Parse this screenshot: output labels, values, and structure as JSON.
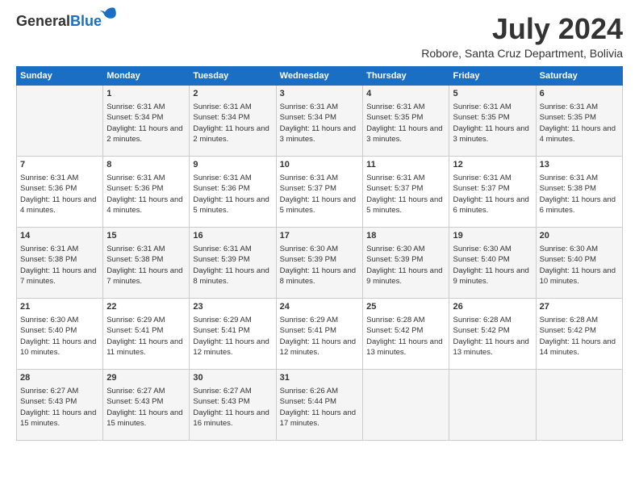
{
  "logo": {
    "general": "General",
    "blue": "Blue"
  },
  "header": {
    "month": "July 2024",
    "location": "Robore, Santa Cruz Department, Bolivia"
  },
  "weekdays": [
    "Sunday",
    "Monday",
    "Tuesday",
    "Wednesday",
    "Thursday",
    "Friday",
    "Saturday"
  ],
  "weeks": [
    [
      {
        "day": "",
        "sunrise": "",
        "sunset": "",
        "daylight": ""
      },
      {
        "day": "1",
        "sunrise": "Sunrise: 6:31 AM",
        "sunset": "Sunset: 5:34 PM",
        "daylight": "Daylight: 11 hours and 2 minutes."
      },
      {
        "day": "2",
        "sunrise": "Sunrise: 6:31 AM",
        "sunset": "Sunset: 5:34 PM",
        "daylight": "Daylight: 11 hours and 2 minutes."
      },
      {
        "day": "3",
        "sunrise": "Sunrise: 6:31 AM",
        "sunset": "Sunset: 5:34 PM",
        "daylight": "Daylight: 11 hours and 3 minutes."
      },
      {
        "day": "4",
        "sunrise": "Sunrise: 6:31 AM",
        "sunset": "Sunset: 5:35 PM",
        "daylight": "Daylight: 11 hours and 3 minutes."
      },
      {
        "day": "5",
        "sunrise": "Sunrise: 6:31 AM",
        "sunset": "Sunset: 5:35 PM",
        "daylight": "Daylight: 11 hours and 3 minutes."
      },
      {
        "day": "6",
        "sunrise": "Sunrise: 6:31 AM",
        "sunset": "Sunset: 5:35 PM",
        "daylight": "Daylight: 11 hours and 4 minutes."
      }
    ],
    [
      {
        "day": "7",
        "sunrise": "Sunrise: 6:31 AM",
        "sunset": "Sunset: 5:36 PM",
        "daylight": "Daylight: 11 hours and 4 minutes."
      },
      {
        "day": "8",
        "sunrise": "Sunrise: 6:31 AM",
        "sunset": "Sunset: 5:36 PM",
        "daylight": "Daylight: 11 hours and 4 minutes."
      },
      {
        "day": "9",
        "sunrise": "Sunrise: 6:31 AM",
        "sunset": "Sunset: 5:36 PM",
        "daylight": "Daylight: 11 hours and 5 minutes."
      },
      {
        "day": "10",
        "sunrise": "Sunrise: 6:31 AM",
        "sunset": "Sunset: 5:37 PM",
        "daylight": "Daylight: 11 hours and 5 minutes."
      },
      {
        "day": "11",
        "sunrise": "Sunrise: 6:31 AM",
        "sunset": "Sunset: 5:37 PM",
        "daylight": "Daylight: 11 hours and 5 minutes."
      },
      {
        "day": "12",
        "sunrise": "Sunrise: 6:31 AM",
        "sunset": "Sunset: 5:37 PM",
        "daylight": "Daylight: 11 hours and 6 minutes."
      },
      {
        "day": "13",
        "sunrise": "Sunrise: 6:31 AM",
        "sunset": "Sunset: 5:38 PM",
        "daylight": "Daylight: 11 hours and 6 minutes."
      }
    ],
    [
      {
        "day": "14",
        "sunrise": "Sunrise: 6:31 AM",
        "sunset": "Sunset: 5:38 PM",
        "daylight": "Daylight: 11 hours and 7 minutes."
      },
      {
        "day": "15",
        "sunrise": "Sunrise: 6:31 AM",
        "sunset": "Sunset: 5:38 PM",
        "daylight": "Daylight: 11 hours and 7 minutes."
      },
      {
        "day": "16",
        "sunrise": "Sunrise: 6:31 AM",
        "sunset": "Sunset: 5:39 PM",
        "daylight": "Daylight: 11 hours and 8 minutes."
      },
      {
        "day": "17",
        "sunrise": "Sunrise: 6:30 AM",
        "sunset": "Sunset: 5:39 PM",
        "daylight": "Daylight: 11 hours and 8 minutes."
      },
      {
        "day": "18",
        "sunrise": "Sunrise: 6:30 AM",
        "sunset": "Sunset: 5:39 PM",
        "daylight": "Daylight: 11 hours and 9 minutes."
      },
      {
        "day": "19",
        "sunrise": "Sunrise: 6:30 AM",
        "sunset": "Sunset: 5:40 PM",
        "daylight": "Daylight: 11 hours and 9 minutes."
      },
      {
        "day": "20",
        "sunrise": "Sunrise: 6:30 AM",
        "sunset": "Sunset: 5:40 PM",
        "daylight": "Daylight: 11 hours and 10 minutes."
      }
    ],
    [
      {
        "day": "21",
        "sunrise": "Sunrise: 6:30 AM",
        "sunset": "Sunset: 5:40 PM",
        "daylight": "Daylight: 11 hours and 10 minutes."
      },
      {
        "day": "22",
        "sunrise": "Sunrise: 6:29 AM",
        "sunset": "Sunset: 5:41 PM",
        "daylight": "Daylight: 11 hours and 11 minutes."
      },
      {
        "day": "23",
        "sunrise": "Sunrise: 6:29 AM",
        "sunset": "Sunset: 5:41 PM",
        "daylight": "Daylight: 11 hours and 12 minutes."
      },
      {
        "day": "24",
        "sunrise": "Sunrise: 6:29 AM",
        "sunset": "Sunset: 5:41 PM",
        "daylight": "Daylight: 11 hours and 12 minutes."
      },
      {
        "day": "25",
        "sunrise": "Sunrise: 6:28 AM",
        "sunset": "Sunset: 5:42 PM",
        "daylight": "Daylight: 11 hours and 13 minutes."
      },
      {
        "day": "26",
        "sunrise": "Sunrise: 6:28 AM",
        "sunset": "Sunset: 5:42 PM",
        "daylight": "Daylight: 11 hours and 13 minutes."
      },
      {
        "day": "27",
        "sunrise": "Sunrise: 6:28 AM",
        "sunset": "Sunset: 5:42 PM",
        "daylight": "Daylight: 11 hours and 14 minutes."
      }
    ],
    [
      {
        "day": "28",
        "sunrise": "Sunrise: 6:27 AM",
        "sunset": "Sunset: 5:43 PM",
        "daylight": "Daylight: 11 hours and 15 minutes."
      },
      {
        "day": "29",
        "sunrise": "Sunrise: 6:27 AM",
        "sunset": "Sunset: 5:43 PM",
        "daylight": "Daylight: 11 hours and 15 minutes."
      },
      {
        "day": "30",
        "sunrise": "Sunrise: 6:27 AM",
        "sunset": "Sunset: 5:43 PM",
        "daylight": "Daylight: 11 hours and 16 minutes."
      },
      {
        "day": "31",
        "sunrise": "Sunrise: 6:26 AM",
        "sunset": "Sunset: 5:44 PM",
        "daylight": "Daylight: 11 hours and 17 minutes."
      },
      {
        "day": "",
        "sunrise": "",
        "sunset": "",
        "daylight": ""
      },
      {
        "day": "",
        "sunrise": "",
        "sunset": "",
        "daylight": ""
      },
      {
        "day": "",
        "sunrise": "",
        "sunset": "",
        "daylight": ""
      }
    ]
  ]
}
